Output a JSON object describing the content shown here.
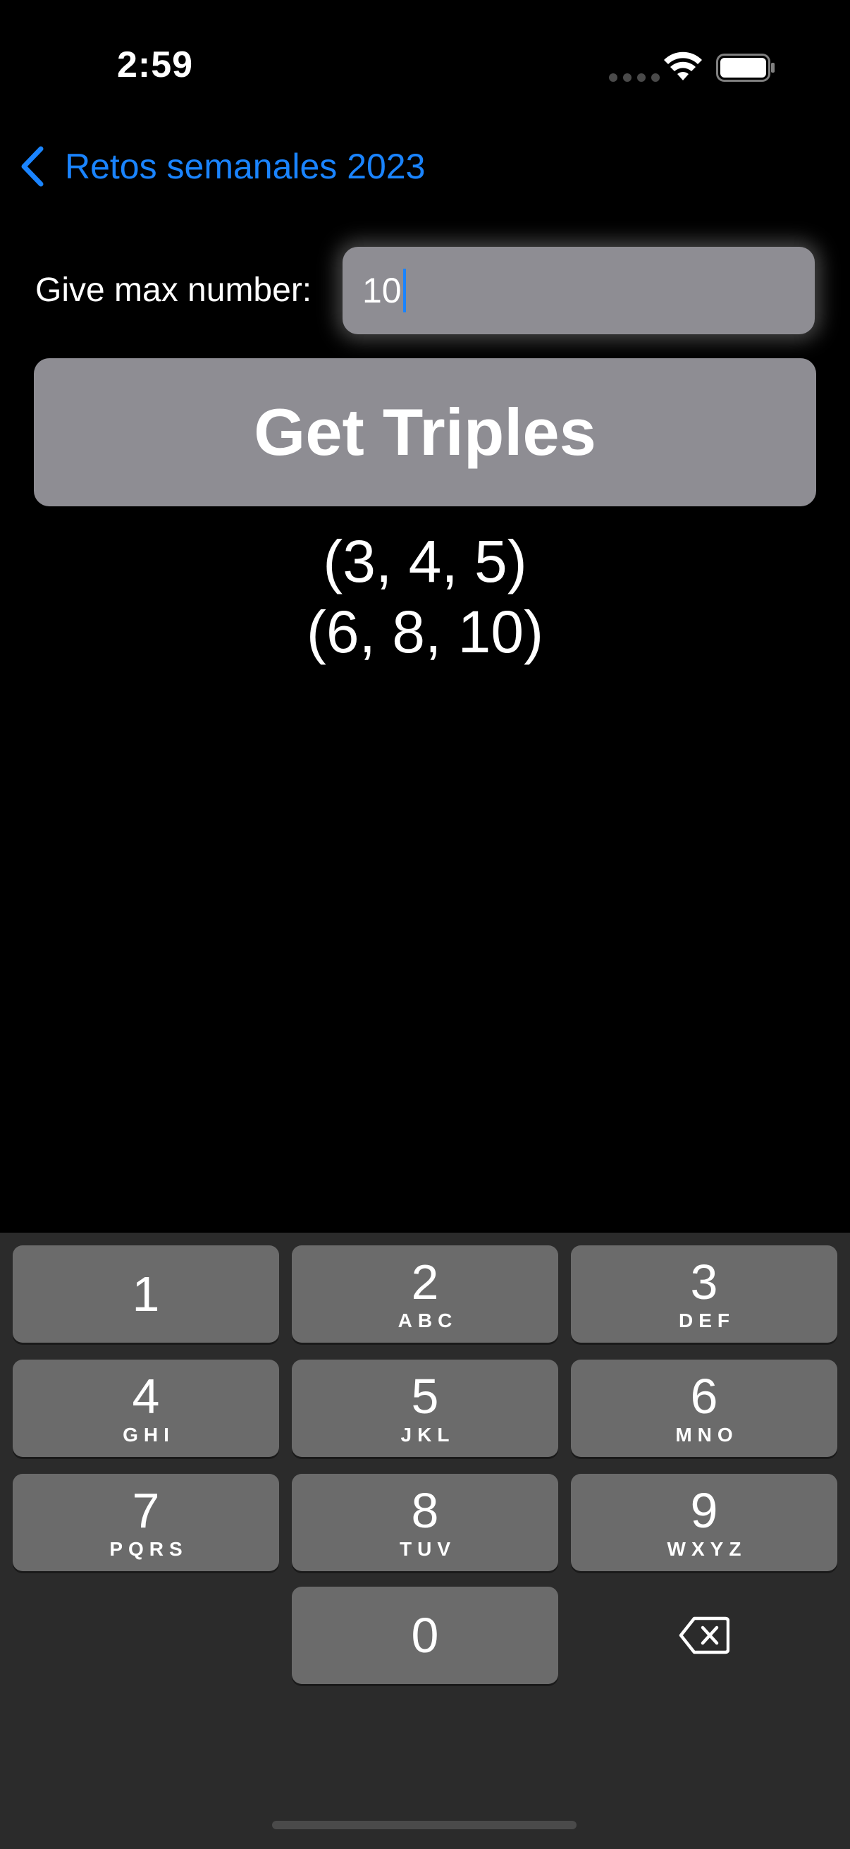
{
  "status_bar": {
    "time": "2:59"
  },
  "nav": {
    "back_label": "Retos semanales 2023"
  },
  "form": {
    "label": "Give max number:",
    "value": "10",
    "button_label": "Get Triples"
  },
  "results": [
    "(3, 4, 5)",
    "(6, 8, 10)"
  ],
  "keyboard": {
    "keys": [
      {
        "digit": "1",
        "letters": ""
      },
      {
        "digit": "2",
        "letters": "ABC"
      },
      {
        "digit": "3",
        "letters": "DEF"
      },
      {
        "digit": "4",
        "letters": "GHI"
      },
      {
        "digit": "5",
        "letters": "JKL"
      },
      {
        "digit": "6",
        "letters": "MNO"
      },
      {
        "digit": "7",
        "letters": "PQRS"
      },
      {
        "digit": "8",
        "letters": "TUV"
      },
      {
        "digit": "9",
        "letters": "WXYZ"
      },
      {
        "digit": "0",
        "letters": ""
      }
    ],
    "delete_icon": "delete-backward-icon"
  },
  "colors": {
    "accent": "#1a84ff",
    "background": "#000000",
    "control_fill": "#8e8d93",
    "keyboard_bg": "#2b2b2b",
    "key_fill": "#6b6b6b"
  }
}
